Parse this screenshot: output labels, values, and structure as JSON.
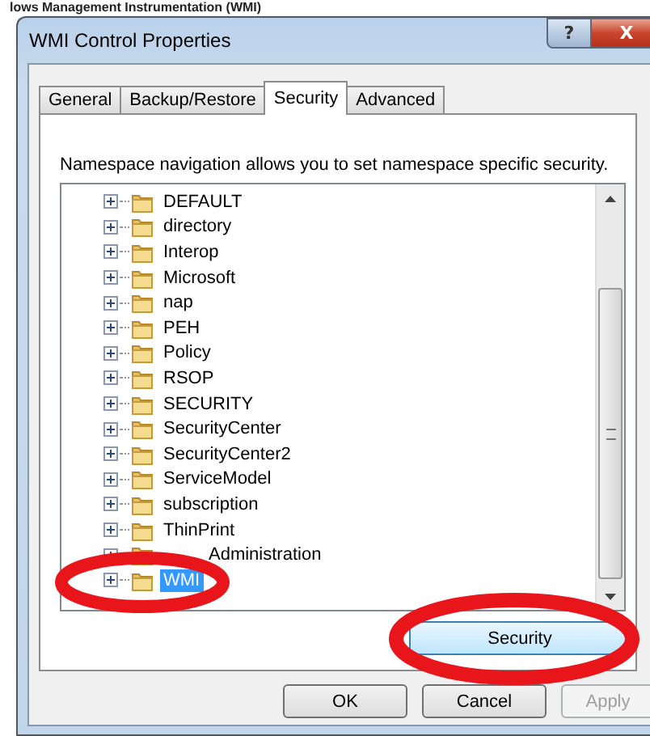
{
  "background": {
    "title": "lows Management Instrumentation (WMI)"
  },
  "window": {
    "title": "WMI Control Properties",
    "help": "?",
    "close": "X"
  },
  "tabs": [
    {
      "label": "General",
      "selected": false
    },
    {
      "label": "Backup/Restore",
      "selected": false
    },
    {
      "label": "Security",
      "selected": true
    },
    {
      "label": "Advanced",
      "selected": false
    }
  ],
  "description": "Namespace navigation allows you to set namespace specific security.",
  "tree": [
    {
      "label": "DEFAULT",
      "selected": false
    },
    {
      "label": "directory",
      "selected": false
    },
    {
      "label": "Interop",
      "selected": false
    },
    {
      "label": "Microsoft",
      "selected": false
    },
    {
      "label": "nap",
      "selected": false
    },
    {
      "label": "PEH",
      "selected": false
    },
    {
      "label": "Policy",
      "selected": false
    },
    {
      "label": "RSOP",
      "selected": false
    },
    {
      "label": "SECURITY",
      "selected": false
    },
    {
      "label": "SecurityCenter",
      "selected": false
    },
    {
      "label": "SecurityCenter2",
      "selected": false
    },
    {
      "label": "ServiceModel",
      "selected": false
    },
    {
      "label": "subscription",
      "selected": false
    },
    {
      "label": "ThinPrint",
      "selected": false
    },
    {
      "label": "Administration",
      "selected": false,
      "covered": true
    },
    {
      "label": "WMI",
      "selected": true
    }
  ],
  "security_button": "Security",
  "buttons": [
    {
      "label": "OK",
      "disabled": false
    },
    {
      "label": "Cancel",
      "disabled": false
    },
    {
      "label": "Apply",
      "disabled": true
    }
  ]
}
